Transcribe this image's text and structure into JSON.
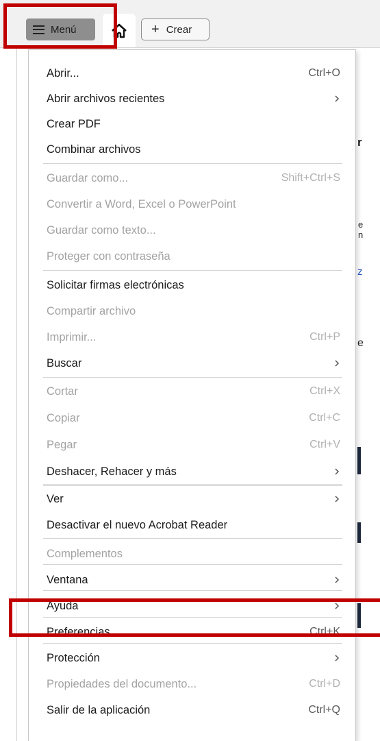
{
  "toolbar": {
    "menu_label": "Menú",
    "create_label": "Crear"
  },
  "background": {
    "fragments": [
      "r",
      "e",
      "n",
      "z",
      "e"
    ]
  },
  "menu": {
    "items": [
      {
        "label": "Abrir...",
        "shortcut": "Ctrl+O",
        "enabled": true,
        "submenu": false
      },
      {
        "label": "Abrir archivos recientes",
        "shortcut": "",
        "enabled": true,
        "submenu": true
      },
      {
        "label": "Crear PDF",
        "shortcut": "",
        "enabled": true,
        "submenu": false
      },
      {
        "label": "Combinar archivos",
        "shortcut": "",
        "enabled": true,
        "submenu": false
      },
      {
        "label": "Guardar como...",
        "shortcut": "Shift+Ctrl+S",
        "enabled": false,
        "submenu": false
      },
      {
        "label": "Convertir a Word, Excel o PowerPoint",
        "shortcut": "",
        "enabled": false,
        "submenu": false
      },
      {
        "label": "Guardar como texto...",
        "shortcut": "",
        "enabled": false,
        "submenu": false
      },
      {
        "label": "Proteger con contraseña",
        "shortcut": "",
        "enabled": false,
        "submenu": false
      },
      {
        "label": "Solicitar firmas electrónicas",
        "shortcut": "",
        "enabled": true,
        "submenu": false
      },
      {
        "label": "Compartir archivo",
        "shortcut": "",
        "enabled": false,
        "submenu": false
      },
      {
        "label": "Imprimir...",
        "shortcut": "Ctrl+P",
        "enabled": false,
        "submenu": false
      },
      {
        "label": "Buscar",
        "shortcut": "",
        "enabled": true,
        "submenu": true
      },
      {
        "label": "Cortar",
        "shortcut": "Ctrl+X",
        "enabled": false,
        "submenu": false
      },
      {
        "label": "Copiar",
        "shortcut": "Ctrl+C",
        "enabled": false,
        "submenu": false
      },
      {
        "label": "Pegar",
        "shortcut": "Ctrl+V",
        "enabled": false,
        "submenu": false
      },
      {
        "label": "Deshacer, Rehacer y más",
        "shortcut": "",
        "enabled": true,
        "submenu": true
      },
      {
        "label": "Ver",
        "shortcut": "",
        "enabled": true,
        "submenu": true
      },
      {
        "label": "Desactivar el nuevo Acrobat Reader",
        "shortcut": "",
        "enabled": true,
        "submenu": false
      },
      {
        "label": "Complementos",
        "shortcut": "",
        "enabled": false,
        "submenu": false
      },
      {
        "label": "Ventana",
        "shortcut": "",
        "enabled": true,
        "submenu": true
      },
      {
        "label": "Ayuda",
        "shortcut": "",
        "enabled": true,
        "submenu": true
      },
      {
        "label": "Preferencias...",
        "shortcut": "Ctrl+K",
        "enabled": true,
        "submenu": false
      },
      {
        "label": "Protección",
        "shortcut": "",
        "enabled": true,
        "submenu": true
      },
      {
        "label": "Propiedades del documento...",
        "shortcut": "Ctrl+D",
        "enabled": false,
        "submenu": false
      },
      {
        "label": "Salir de la aplicación",
        "shortcut": "Ctrl+Q",
        "enabled": true,
        "submenu": false
      }
    ]
  },
  "colors": {
    "highlight": "#c00000",
    "enabled_text": "#1b1b1b",
    "disabled_text": "#a3a3a3"
  }
}
